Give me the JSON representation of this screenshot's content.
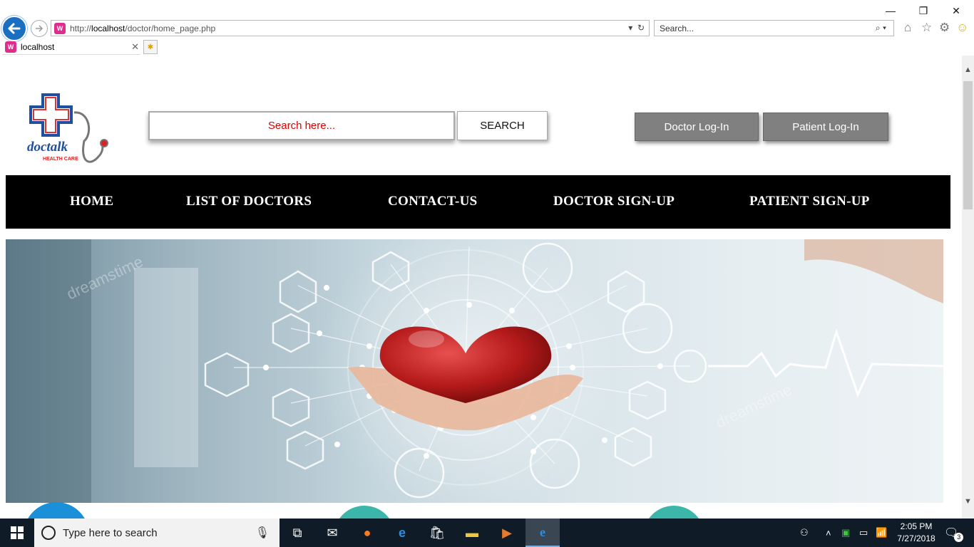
{
  "browser": {
    "url_prefix": "http://",
    "url_host": "localhost",
    "url_path": "/doctor/home_page.php",
    "search_placeholder": "Search...",
    "tab_title": "localhost",
    "favicon_letter": "W",
    "window_controls": {
      "minimize": "—",
      "maximize": "❐",
      "close": "✕"
    }
  },
  "site": {
    "logo_text": "doctalk",
    "logo_subtext": "HEALTH CARE",
    "search_placeholder": "Search here...",
    "search_button": "SEARCH",
    "doctor_login": "Doctor Log-In",
    "patient_login": "Patient Log-In",
    "nav": {
      "home": "HOME",
      "list_of_doctors": "LIST OF DOCTORS",
      "contact_us": "CONTACT-US",
      "doctor_signup": "DOCTOR SIGN-UP",
      "patient_signup": "PATIENT SIGN-UP"
    },
    "hero_watermark": "dreamstime"
  },
  "taskbar": {
    "search_placeholder": "Type here to search",
    "time": "2:05 PM",
    "date": "7/27/2018",
    "notification_count": "3",
    "apps": [
      "task-view",
      "mail",
      "firefox",
      "edge",
      "store",
      "file-explorer",
      "media",
      "internet-explorer"
    ]
  },
  "colors": {
    "nav_bg": "#000000",
    "login_btn_bg": "#808080",
    "search_placeholder_color": "#dd0000",
    "ie_blue": "#1b6fc2"
  }
}
